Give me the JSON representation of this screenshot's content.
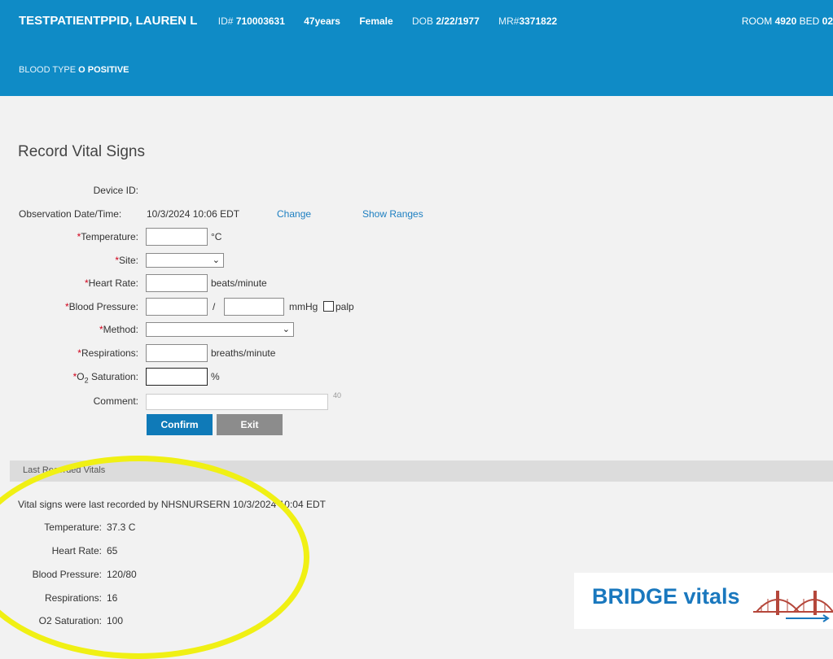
{
  "header": {
    "patient_name": "TESTPATIENTPPID, LAUREN L",
    "id_label": "ID#",
    "id_value": "710003631",
    "age": "47years",
    "sex": "Female",
    "dob_label": "DOB",
    "dob_value": "2/22/1977",
    "mr_label": "MR#",
    "mr_value": "3371822",
    "room_label": "ROOM",
    "room_value": "4920",
    "bed_label": "BED",
    "bed_value": "02",
    "blood_label": "BLOOD TYPE",
    "blood_value": "O POSITIVE"
  },
  "page_title": "Record Vital Signs",
  "form": {
    "device_id_label": "Device ID:",
    "obs_label": "Observation Date/Time:",
    "obs_value": "10/3/2024 10:06 EDT",
    "change_link": "Change",
    "show_ranges_link": "Show Ranges",
    "required_mark": "*",
    "temperature_label": "Temperature:",
    "temperature_value": "",
    "temperature_unit": "°C",
    "site_label": "Site:",
    "site_value": "",
    "heart_rate_label": "Heart Rate:",
    "heart_rate_value": "",
    "heart_rate_unit": "beats/minute",
    "bp_label": "Blood Pressure:",
    "bp_systolic": "",
    "bp_diastolic": "",
    "bp_sep": "/",
    "bp_unit": "mmHg",
    "palp_label": "palp",
    "method_label": "Method:",
    "method_value": "",
    "resp_label": "Respirations:",
    "resp_value": "",
    "resp_unit": "breaths/minute",
    "o2_label_prefix": "O",
    "o2_label_sub": "2",
    "o2_label_suffix": " Saturation:",
    "o2_value": "",
    "o2_unit": "%",
    "comment_label": "Comment:",
    "comment_value": "",
    "comment_max": "40",
    "confirm_label": "Confirm",
    "exit_label": "Exit"
  },
  "last_recorded": {
    "section_title": "Last Recorded Vitals",
    "recorded_by_line": "Vital signs were last recorded by NHSNURSERN 10/3/2024 10:04 EDT",
    "rows": [
      {
        "label": "Temperature:",
        "value": "37.3 C"
      },
      {
        "label": "Heart Rate:",
        "value": "65"
      },
      {
        "label": "Blood Pressure:",
        "value": "120/80"
      },
      {
        "label": "Respirations:",
        "value": "16"
      },
      {
        "label": "O2 Saturation:",
        "value": "100"
      }
    ]
  },
  "logo_text": "BRIDGE vitals",
  "colors": {
    "header_bg": "#0f8bc6",
    "confirm_bg": "#0f7ab8",
    "exit_bg": "#8c8c8c",
    "required": "#d0021b",
    "link": "#1d7fc1",
    "annotation": "#f0f014"
  }
}
